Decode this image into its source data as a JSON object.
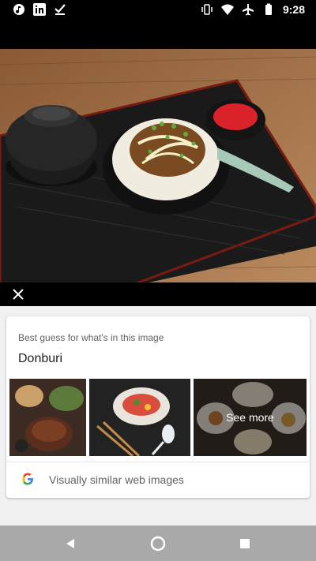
{
  "status_bar": {
    "time": "9:28",
    "left_icons": [
      "music-note-icon",
      "linkedin-icon",
      "checkmark-icon"
    ],
    "right_icons": [
      "vibrate-icon",
      "wifi-icon",
      "airplane-icon",
      "battery-icon"
    ]
  },
  "photo": {
    "subject": "donburi-photo"
  },
  "close_icon": "close-icon",
  "result_card": {
    "caption": "Best guess for what's in this image",
    "guess": "Donburi",
    "thumbnails": [
      "thumbnail-1",
      "thumbnail-2",
      "thumbnail-3"
    ],
    "see_more_label": "See more",
    "similar_label": "Visually similar web images",
    "google_icon": "google-logo-icon"
  },
  "nav_bar": {
    "buttons": [
      "back-icon",
      "home-icon",
      "recents-icon"
    ]
  }
}
